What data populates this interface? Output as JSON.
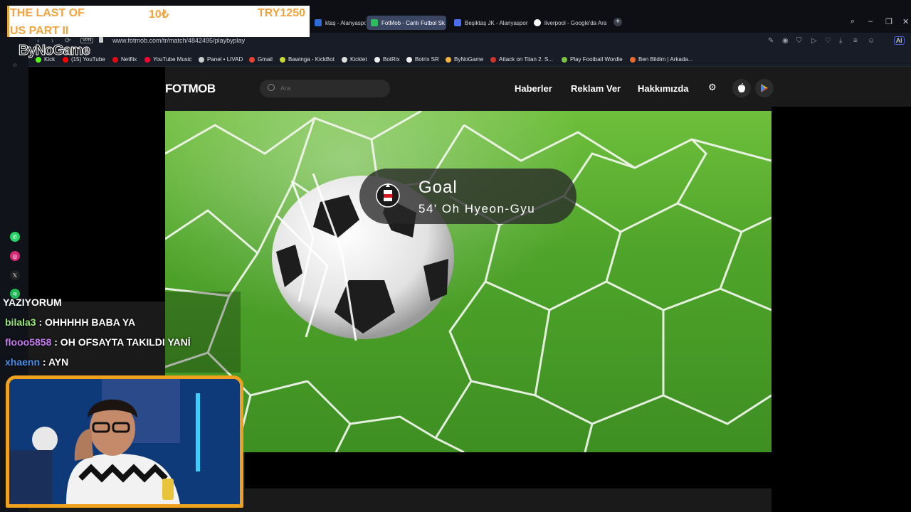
{
  "browser": {
    "tabs": [
      {
        "label": "ktaş - Alanyaspor canl",
        "active": false,
        "color": "#2b6cd6"
      },
      {
        "label": "FotMob - Canlı Futbol Sk",
        "active": true,
        "color": "#2dbd5f"
      },
      {
        "label": "Beşiktaş JK - Alanyaspor c",
        "active": false,
        "color": "#4c6ef5"
      },
      {
        "label": "liverpool - Google'da Ara",
        "active": false,
        "color": "#ffffff"
      }
    ],
    "new_tab": "+",
    "url": "www.fotmob.com/tr/match/4842495/playbyplay",
    "vpn": "VPN",
    "ai_label": "AI",
    "bookmarks": [
      {
        "label": "Kick",
        "color": "#53fc18"
      },
      {
        "label": "(15) YouTube",
        "color": "#ff0000"
      },
      {
        "label": "Netflix",
        "color": "#e50914"
      },
      {
        "label": "YouTube Music",
        "color": "#ff0033"
      },
      {
        "label": "Panel • LIVAD",
        "color": "#cccccc"
      },
      {
        "label": "Gmail",
        "color": "#ea4335"
      },
      {
        "label": "Bawinga - KickBot",
        "color": "#c9d82e"
      },
      {
        "label": "Kicklet",
        "color": "#dddddd"
      },
      {
        "label": "BotRix",
        "color": "#eeeeee"
      },
      {
        "label": "Botrix SR",
        "color": "#eeeeee"
      },
      {
        "label": "ByNoGame",
        "color": "#f3b33d"
      },
      {
        "label": "Attack on Titan 2. S...",
        "color": "#d0342c"
      },
      {
        "label": "Play Football Wordle",
        "color": "#7cc242"
      },
      {
        "label": "Ben Bildim | Arkada...",
        "color": "#e86a2c"
      }
    ]
  },
  "overlay": {
    "game_name_line1": "THE LAST OF",
    "game_name_line2": "US PART II",
    "price_small": "10₺",
    "price": "TRY1250",
    "brand": "ByNoGame"
  },
  "fotmob": {
    "logo": "FOTMOB",
    "search_placeholder": "Ara",
    "nav": [
      "Haberler",
      "Reklam Ver",
      "Hakkımızda"
    ],
    "goal": {
      "title": "Goal",
      "scorer": "54'  Oh  Hyeon-Gyu"
    }
  },
  "chat": {
    "header": "YAZIYORUM",
    "messages": [
      {
        "user": "bilala3",
        "text": " : OHHHHH BABA YA",
        "color": "#9be87a"
      },
      {
        "user": "flooo5858",
        "text": " : OH OFSAYTA TAKILDI YANİ",
        "color": "#c57df0"
      },
      {
        "user": "xhaenn",
        "text": " : AYN",
        "color": "#4c8fe8"
      }
    ]
  },
  "colors": {
    "accent_orange": "#f0a21f",
    "active_tab": "#3b4662",
    "page_bg": "#1a1a1a"
  }
}
